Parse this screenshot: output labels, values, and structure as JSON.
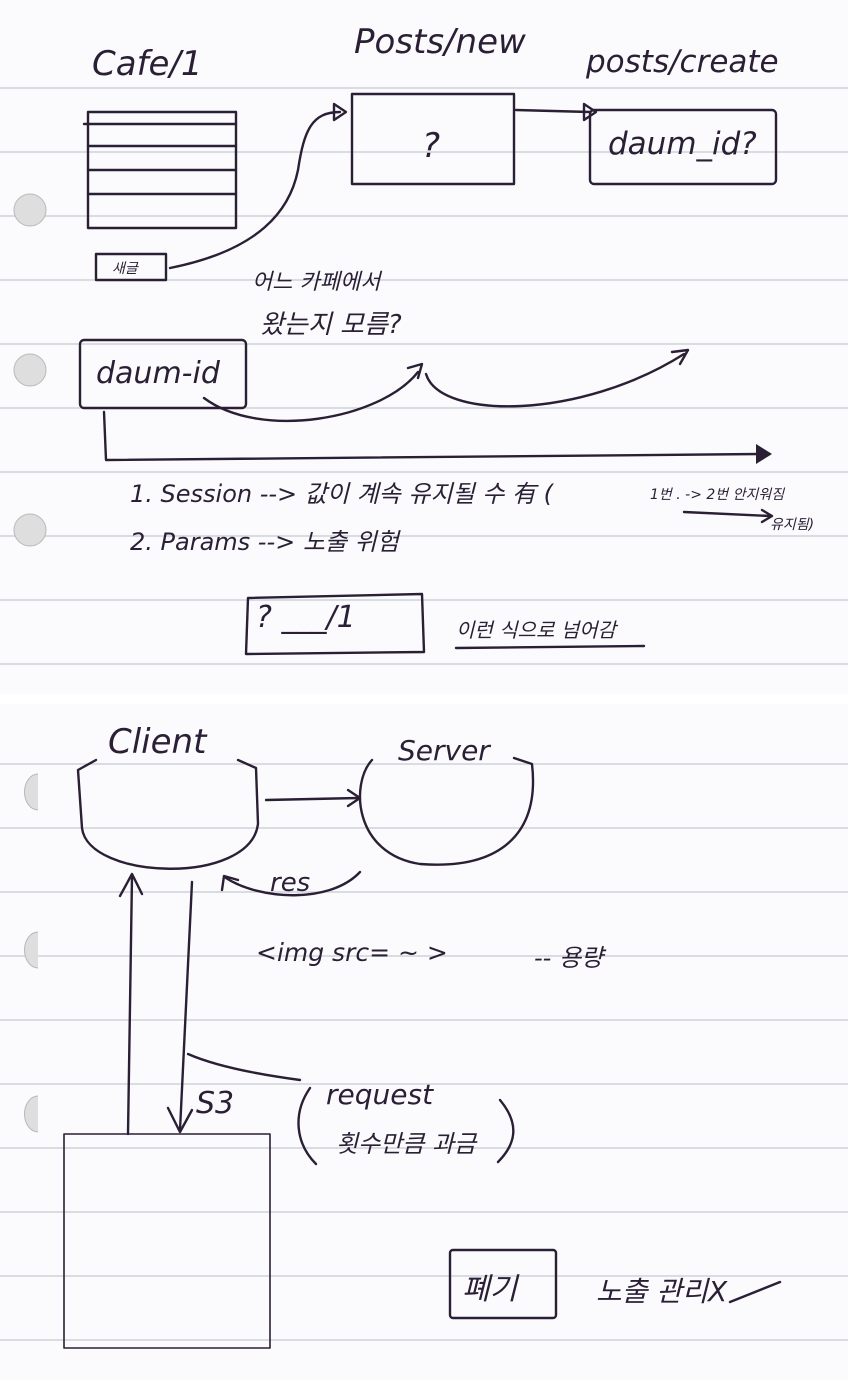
{
  "top": {
    "headings": {
      "cafe": "Cafe/1",
      "posts_new": "Posts/new",
      "posts_create": "posts/create"
    },
    "new_box_mark": "?",
    "create_box_label": "daum_id?",
    "write_button": "새글",
    "question_line1": "어느 카페에서",
    "question_line2": "왔는지 모름?",
    "daum_id_box": "daum-id",
    "option1": "1. Session --> 값이 계속 유지될 수 有 (",
    "option1_note": "1번 . -> 2번 안지워짐",
    "option1_note2": "유지됨)",
    "option2": "2. Params --> 노출 위험",
    "url_box": "? ___/1",
    "url_caption": "이런 식으로 넘어감"
  },
  "bottom": {
    "client_label": "Client",
    "server_label": "Server",
    "res_label": "res",
    "img_tag": "<img src= ~ >",
    "capacity_note": "-- 용량",
    "s3_label": "S3",
    "request_line1": "request",
    "request_line2": "횟수만큼 과금",
    "delete_box": "폐기",
    "exposure_note": "노출 관리X"
  }
}
